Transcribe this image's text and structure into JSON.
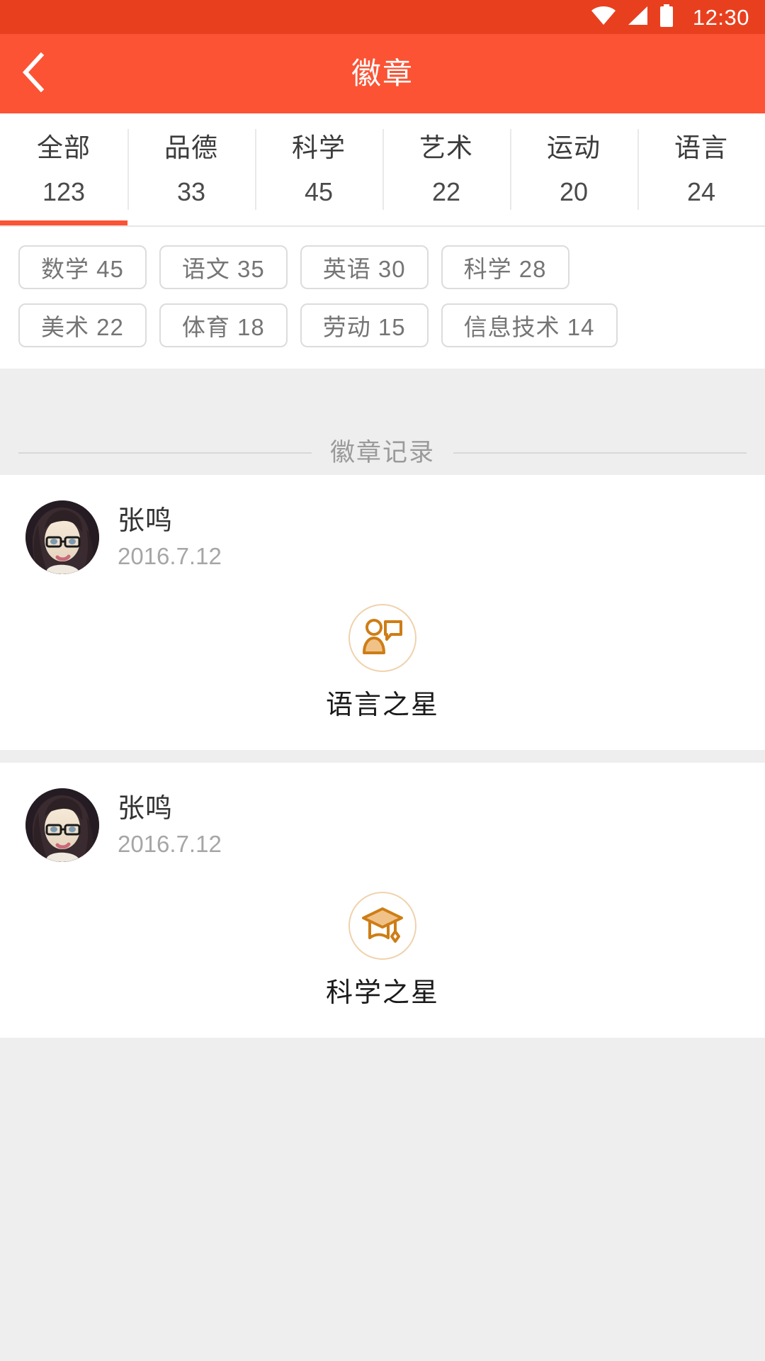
{
  "status_bar": {
    "time": "12:30",
    "icons": [
      "wifi-icon",
      "cellular-signal-icon",
      "battery-icon"
    ]
  },
  "app_bar": {
    "title": "徽章",
    "back_icon": "chevron-left-icon",
    "background_color": "#FB5334"
  },
  "tabs": {
    "active_index": 0,
    "indicator_color": "#FB5334",
    "items": [
      {
        "label": "全部",
        "count": "123"
      },
      {
        "label": "品德",
        "count": "33"
      },
      {
        "label": "科学",
        "count": "45"
      },
      {
        "label": "艺术",
        "count": "22"
      },
      {
        "label": "运动",
        "count": "20"
      },
      {
        "label": "语言",
        "count": "24"
      }
    ]
  },
  "chips": {
    "row1": [
      {
        "label": "数学 45"
      },
      {
        "label": "语文 35"
      },
      {
        "label": "英语 30"
      },
      {
        "label": "科学 28"
      }
    ],
    "row2": [
      {
        "label": "美术 22"
      },
      {
        "label": "体育 18"
      },
      {
        "label": "劳动 15"
      },
      {
        "label": "信息技术 14"
      }
    ]
  },
  "section": {
    "title": "徽章记录"
  },
  "records": [
    {
      "name": "张鸣",
      "date": "2016.7.12",
      "avatar": "user-photo-avatar",
      "badge_icon": "person-speech-bubble-icon",
      "badge_name": "语言之星",
      "badge_color": "#CE7D16"
    },
    {
      "name": "张鸣",
      "date": "2016.7.12",
      "avatar": "user-photo-avatar",
      "badge_icon": "graduation-cap-icon",
      "badge_name": "科学之星",
      "badge_color": "#CE7D16"
    }
  ]
}
